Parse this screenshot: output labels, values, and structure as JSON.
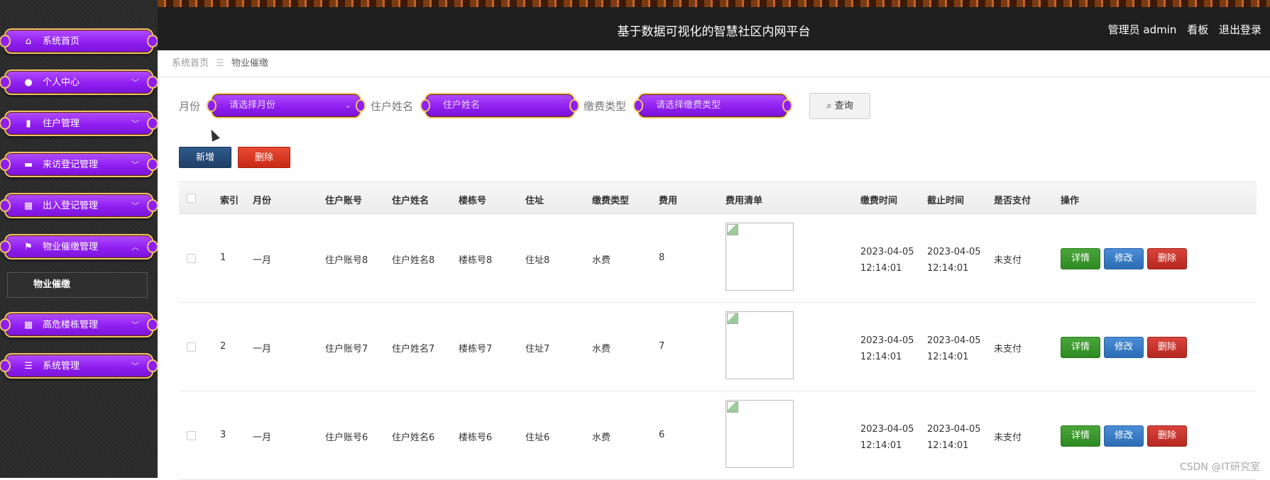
{
  "header": {
    "title": "基于数据可视化的智慧社区内网平台",
    "user": "管理员 admin",
    "dashboard_link": "看板",
    "logout_link": "退出登录"
  },
  "sidebar": {
    "items": [
      {
        "label": "系统首页",
        "icon": "home-icon"
      },
      {
        "label": "个人中心",
        "icon": "user-icon",
        "arrow": "﹀"
      },
      {
        "label": "住户管理",
        "icon": "building-icon",
        "arrow": "﹀"
      },
      {
        "label": "来访登记管理",
        "icon": "printer-icon",
        "arrow": "﹀"
      },
      {
        "label": "出入登记管理",
        "icon": "grid-icon",
        "arrow": "﹀"
      },
      {
        "label": "物业催缴管理",
        "icon": "flag-icon",
        "arrow": "︿"
      },
      {
        "label": "高危楼栋管理",
        "icon": "grid-icon",
        "arrow": "﹀"
      },
      {
        "label": "系统管理",
        "icon": "sliders-icon",
        "arrow": "﹀"
      }
    ],
    "submenu": {
      "label": "物业催缴"
    }
  },
  "breadcrumb": {
    "home": "系统首页",
    "separator": "☰",
    "current": "物业催缴"
  },
  "search": {
    "month_label": "月份",
    "month_placeholder": "请选择月份",
    "name_label": "住户姓名",
    "name_placeholder": "住户姓名",
    "type_label": "缴费类型",
    "type_placeholder": "请选择缴费类型",
    "query_button": "查询"
  },
  "actions": {
    "add": "新增",
    "delete": "删除"
  },
  "table": {
    "headers": {
      "index": "索引",
      "month": "月份",
      "account": "住户账号",
      "name": "住户姓名",
      "building": "楼栋号",
      "address": "住址",
      "fee_type": "缴费类型",
      "fee": "费用",
      "fee_list": "费用清单",
      "pay_time": "缴费时间",
      "deadline": "截止时间",
      "paid": "是否支付",
      "ops": "操作"
    },
    "rows": [
      {
        "index": "1",
        "month": "一月",
        "account": "住户账号8",
        "name": "住户姓名8",
        "building": "楼栋号8",
        "address": "住址8",
        "fee_type": "水费",
        "fee": "8",
        "pay_date": "2023-04-05",
        "pay_clock": "12:14:01",
        "deadline_date": "2023-04-05",
        "deadline_clock": "12:14:01",
        "paid": "未支付",
        "detail": "详情",
        "edit": "修改",
        "del": "删除"
      },
      {
        "index": "2",
        "month": "一月",
        "account": "住户账号7",
        "name": "住户姓名7",
        "building": "楼栋号7",
        "address": "住址7",
        "fee_type": "水费",
        "fee": "7",
        "pay_date": "2023-04-05",
        "pay_clock": "12:14:01",
        "deadline_date": "2023-04-05",
        "deadline_clock": "12:14:01",
        "paid": "未支付",
        "detail": "详情",
        "edit": "修改",
        "del": "删除"
      },
      {
        "index": "3",
        "month": "一月",
        "account": "住户账号6",
        "name": "住户姓名6",
        "building": "楼栋号6",
        "address": "住址6",
        "fee_type": "水费",
        "fee": "6",
        "pay_date": "2023-04-05",
        "pay_clock": "12:14:01",
        "deadline_date": "2023-04-05",
        "deadline_clock": "12:14:01",
        "paid": "未支付",
        "detail": "详情",
        "edit": "修改",
        "del": "删除"
      }
    ]
  },
  "watermark": "CSDN @IT研究室"
}
